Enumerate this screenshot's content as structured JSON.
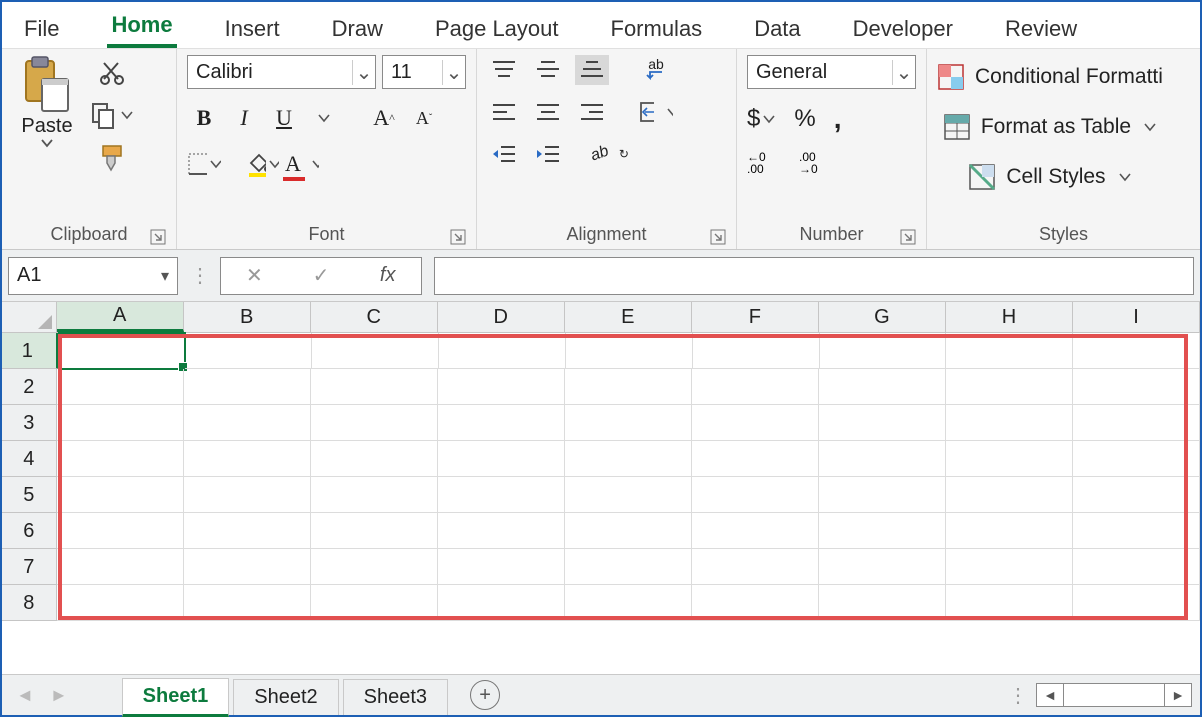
{
  "tabs": {
    "file": "File",
    "home": "Home",
    "insert": "Insert",
    "draw": "Draw",
    "page_layout": "Page Layout",
    "formulas": "Formulas",
    "data": "Data",
    "developer": "Developer",
    "review": "Review",
    "active": "home"
  },
  "clipboard": {
    "paste": "Paste",
    "label": "Clipboard"
  },
  "font": {
    "name": "Calibri",
    "size": "11",
    "label": "Font",
    "bold": "B",
    "italic": "I",
    "underline": "U",
    "incA": "A",
    "decA": "A",
    "colorA": "A"
  },
  "alignment": {
    "label": "Alignment",
    "wrap": "ab"
  },
  "number": {
    "format": "General",
    "label": "Number",
    "currency": "$",
    "percent": "%",
    "comma": ",",
    "inc": ".0",
    "dec": ".00"
  },
  "styles": {
    "label": "Styles",
    "conditional": "Conditional Formatti",
    "table": "Format as Table",
    "cell": "Cell Styles"
  },
  "namebox": "A1",
  "fx": "fx",
  "columns": [
    "A",
    "B",
    "C",
    "D",
    "E",
    "F",
    "G",
    "H",
    "I"
  ],
  "rows": [
    "1",
    "2",
    "3",
    "4",
    "5",
    "6",
    "7",
    "8"
  ],
  "active_cell": "A1",
  "sheets": {
    "s1": "Sheet1",
    "s2": "Sheet2",
    "s3": "Sheet3",
    "active": "s1"
  }
}
